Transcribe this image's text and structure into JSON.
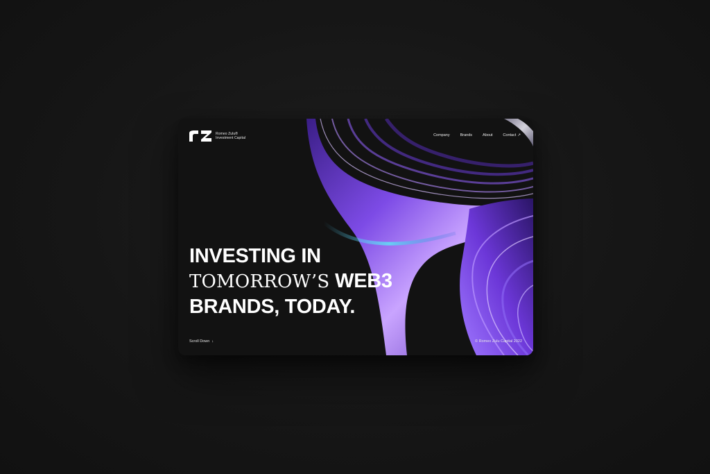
{
  "brand": {
    "name_line1": "Romeo Zulu®",
    "name_line2": "Investment Capital"
  },
  "nav": {
    "items": [
      {
        "label": "Company"
      },
      {
        "label": "Brands"
      },
      {
        "label": "About"
      },
      {
        "label": "Contact"
      }
    ],
    "contact_arrow": "↗"
  },
  "hero": {
    "line1": "INVESTING IN",
    "line2_serif": "TOMORROW’S",
    "line2_rest": "WEB3",
    "line3": "BRANDS, TODAY."
  },
  "footer": {
    "scroll_label": "Scroll Down",
    "scroll_arrow": "↓",
    "copyright": "© Romeo Zulu Capital 2022"
  },
  "colors": {
    "page_background": "#161616",
    "card_background": "#121212",
    "text": "#ffffff",
    "accent_purple": "#7b3fe4",
    "accent_violet": "#5b2bc7",
    "accent_cyan": "#55d8f0"
  }
}
